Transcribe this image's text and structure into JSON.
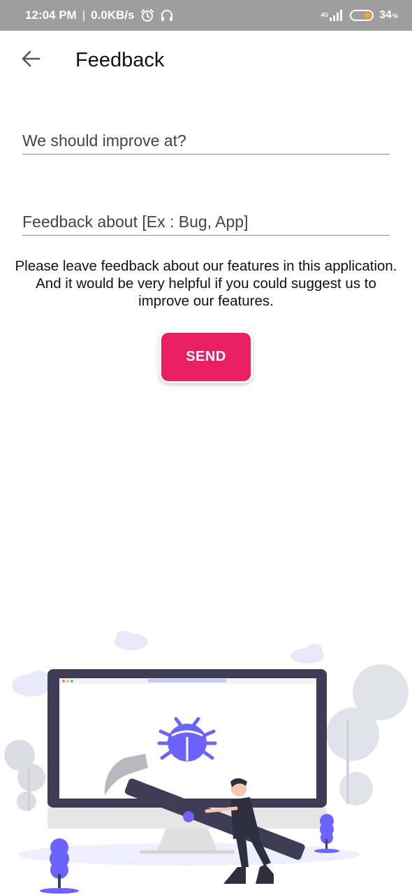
{
  "status_bar": {
    "time": "12:04 PM",
    "separator": "|",
    "network_speed": "0.0KB/s",
    "network_type": "4G",
    "battery_percent": "34",
    "battery_suffix": "%",
    "battery_level": 0.34,
    "battery_color": "#f5a623",
    "icons": [
      "alarm-icon",
      "headphones-icon",
      "signal-icon",
      "battery-icon"
    ]
  },
  "app_bar": {
    "title": "Feedback",
    "back_icon": "arrow-left-icon"
  },
  "form": {
    "improve_field": {
      "value": "",
      "placeholder": "We should improve at?"
    },
    "about_field": {
      "value": "",
      "placeholder": "Feedback about [Ex : Bug, App]"
    }
  },
  "info": {
    "lines": [
      "Please leave feedback about our features in this application.",
      "And it would be very helpful if you could suggest us to",
      "improve our features."
    ]
  },
  "send_button": {
    "label": "SEND",
    "color": "#e91e63"
  },
  "illustration": {
    "name": "bug-fixing-illustration",
    "accent_color": "#6c63ff",
    "dark_color": "#3f3d56"
  }
}
